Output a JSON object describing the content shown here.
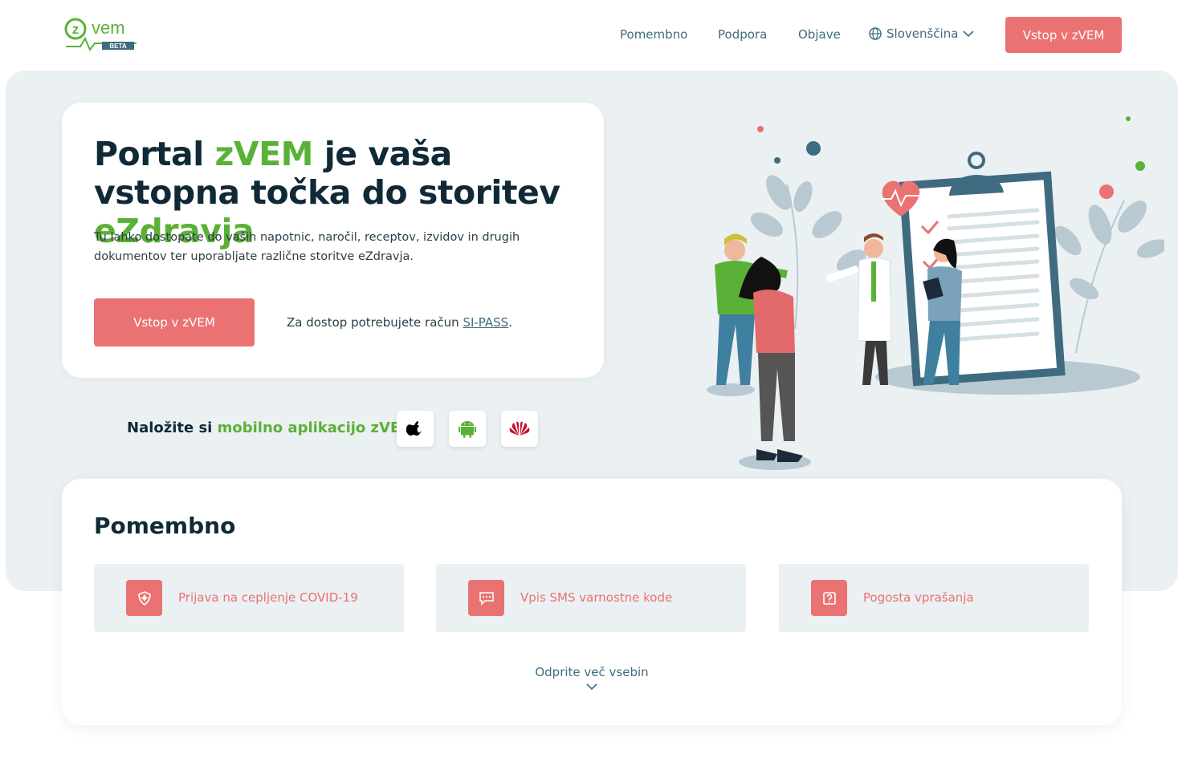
{
  "header": {
    "logo_text": "vem",
    "logo_letter": "z",
    "logo_badge": "BETA",
    "nav": [
      "Pomembno",
      "Podpora",
      "Objave"
    ],
    "language": "Slovenščina",
    "login_button": "Vstop v zVEM"
  },
  "hero": {
    "title_part1": "Portal ",
    "title_brand": "zVEM",
    "title_part2": " je vaša vstopna točka do storitev ",
    "title_brand2": "eZdravja",
    "description": "Tu lahko dostopate do vaših napotnic, naročil, receptov, izvidov in drugih dokumentov ter uporabljate različne storitve eZdravja.",
    "login_button": "Vstop v zVEM",
    "sipass_prefix": "Za dostop potrebujete račun ",
    "sipass_link": "SI-PASS",
    "sipass_suffix": "."
  },
  "app": {
    "text_prefix": "Naložite si ",
    "text_highlight": "mobilno aplikacijo zVEM",
    "stores": [
      "apple-icon",
      "android-icon",
      "huawei-icon"
    ]
  },
  "important": {
    "title": "Pomembno",
    "tiles": [
      {
        "label": "Prijava na cepljenje COVID-19",
        "icon": "shield-virus-icon"
      },
      {
        "label": "Vpis SMS varnostne kode",
        "icon": "sms-code-icon"
      },
      {
        "label": "Pogosta vprašanja",
        "icon": "question-icon"
      }
    ],
    "more_label": "Odprite več vsebin"
  },
  "colors": {
    "accent": "#ea7272",
    "green": "#5ab137",
    "dark": "#0f2a36",
    "link": "#3f6b80",
    "hero_bg": "#ebf0f3"
  }
}
